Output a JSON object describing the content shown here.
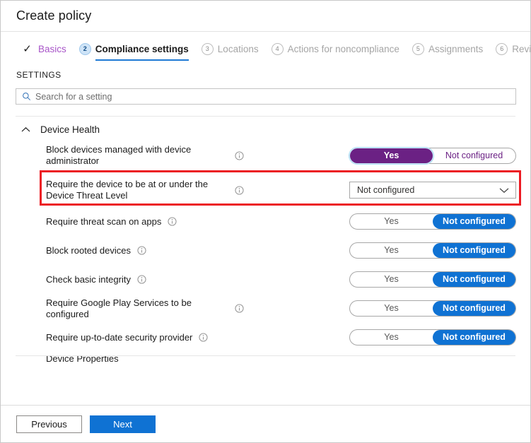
{
  "window": {
    "title": "Create policy"
  },
  "wizard": {
    "steps": [
      {
        "marker": "✓",
        "label": "Basics",
        "state": "done"
      },
      {
        "marker": "2",
        "label": "Compliance settings",
        "state": "current"
      },
      {
        "marker": "3",
        "label": "Locations",
        "state": "upcoming"
      },
      {
        "marker": "4",
        "label": "Actions for noncompliance",
        "state": "upcoming"
      },
      {
        "marker": "5",
        "label": "Assignments",
        "state": "upcoming"
      },
      {
        "marker": "6",
        "label": "Review",
        "state": "upcoming"
      }
    ]
  },
  "settings": {
    "heading": "SETTINGS",
    "search": {
      "placeholder": "Search for a setting",
      "value": "",
      "icon": "search-icon"
    },
    "group": {
      "title": "Device Health",
      "expanded": true,
      "chevron_icon": "chevron-up-icon"
    },
    "rows": [
      {
        "label": "Block devices managed with device administrator",
        "info_icon": "info-icon",
        "control": "toggle",
        "options": [
          "Yes",
          "Not configured"
        ],
        "selected": "Yes",
        "accent": "#6b2184",
        "highlighted": true,
        "focused": true
      },
      {
        "label": "Require the device to be at or under the Device Threat Level",
        "info_icon": "info-icon",
        "control": "dropdown",
        "value": "Not configured",
        "chevron_icon": "chevron-down-icon"
      },
      {
        "label": "Require threat scan on apps",
        "info_icon": "info-icon",
        "control": "toggle",
        "options": [
          "Yes",
          "Not configured"
        ],
        "selected": "Not configured",
        "accent": "#0f72d3"
      },
      {
        "label": "Block rooted devices",
        "info_icon": "info-icon",
        "control": "toggle",
        "options": [
          "Yes",
          "Not configured"
        ],
        "selected": "Not configured",
        "accent": "#0f72d3"
      },
      {
        "label": "Check basic integrity",
        "info_icon": "info-icon",
        "control": "toggle",
        "options": [
          "Yes",
          "Not configured"
        ],
        "selected": "Not configured",
        "accent": "#0f72d3"
      },
      {
        "label": "Require Google Play Services to be configured",
        "info_icon": "info-icon",
        "control": "toggle",
        "options": [
          "Yes",
          "Not configured"
        ],
        "selected": "Not configured",
        "accent": "#0f72d3"
      },
      {
        "label": "Require up-to-date security provider",
        "info_icon": "info-icon",
        "control": "toggle",
        "options": [
          "Yes",
          "Not configured"
        ],
        "selected": "Not configured",
        "accent": "#0f72d3"
      }
    ],
    "next_group_partial": "Device Properties"
  },
  "footer": {
    "previous_label": "Previous",
    "next_label": "Next"
  },
  "annotation": {
    "highlight_color": "#ec1c24"
  }
}
